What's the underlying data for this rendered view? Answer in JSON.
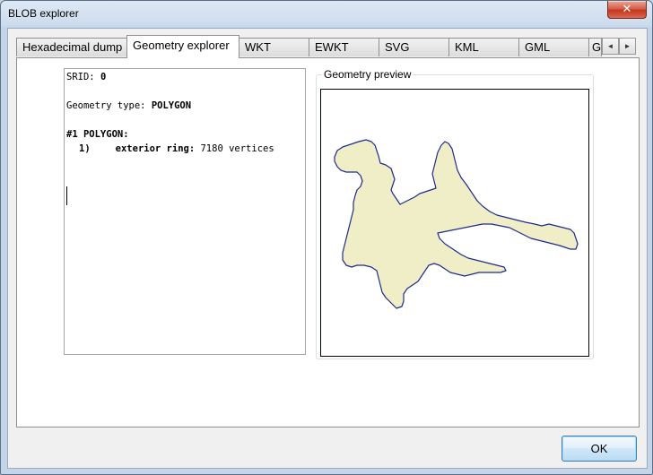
{
  "window": {
    "title": "BLOB explorer",
    "close_glyph": "✕"
  },
  "tabs": [
    {
      "label": "Hexadecimal dump"
    },
    {
      "label": "Geometry explorer"
    },
    {
      "label": "WKT"
    },
    {
      "label": "EWKT"
    },
    {
      "label": "SVG"
    },
    {
      "label": "KML"
    },
    {
      "label": "GML"
    },
    {
      "label": "G"
    }
  ],
  "active_tab": "Geometry explorer",
  "tab_scroll": {
    "left": "◄",
    "right": "►"
  },
  "info": {
    "srid_label": "SRID: ",
    "srid_value": "0",
    "type_label": "Geometry type: ",
    "type_value": "POLYGON",
    "item_header": "#1 POLYGON:",
    "ring_index": "1)",
    "ring_label": "exterior ring: ",
    "ring_value": "7180 vertices"
  },
  "preview": {
    "label": "Geometry preview",
    "fill_color": "#f0eec6",
    "stroke_color": "#1e2b8f"
  },
  "buttons": {
    "ok": "OK"
  }
}
